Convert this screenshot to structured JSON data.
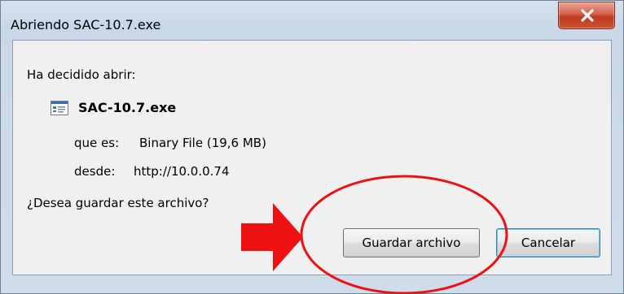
{
  "window": {
    "title": "Abriendo SAC-10.7.exe",
    "close_label": "X"
  },
  "dialog": {
    "intro": "Ha decidido abrir:",
    "file_name": "SAC-10.7.exe",
    "type_label": "que es:",
    "type_value": "Binary File (19,6 MB)",
    "from_label": "desde:",
    "from_value": "http://10.0.0.74",
    "question": "¿Desea guardar este archivo?"
  },
  "buttons": {
    "save": "Guardar archivo",
    "cancel": "Cancelar"
  },
  "colors": {
    "annotation": "#ee1111"
  },
  "icons": {
    "file": "executable-file-icon",
    "close": "close-icon",
    "arrow": "red-arrow-icon",
    "circle": "red-ellipse-highlight"
  }
}
